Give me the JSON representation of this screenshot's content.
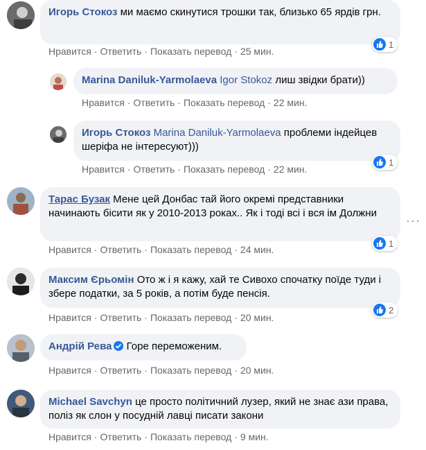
{
  "actions": {
    "like": "Нравится",
    "reply": "Ответить",
    "translate": "Показать перевод"
  },
  "comments": [
    {
      "author": "Игорь Стокоз",
      "text": "ми маємо скинутися трошки так, близько 65 ярдів грн.",
      "time": "25 мин.",
      "likes": "1"
    },
    {
      "author": "Marina Daniluk-Yarmolaeva",
      "mention": "Igor Stokoz",
      "text": "лиш звідки брати))",
      "time": "22 мин."
    },
    {
      "author": "Игорь Стокоз",
      "mention": "Marina Daniluk-Yarmolaeva",
      "text": "проблеми індейцев шеріфа не інтересуют)))",
      "time": "22 мин.",
      "likes": "1"
    },
    {
      "author": "Тарас Бузак",
      "text": "Мене цей Донбас тай його окремі представники начинають бісити як у 2010-2013 роках.. Як і тоді всі і вся ім Должни",
      "time": "24 мин.",
      "likes": "1"
    },
    {
      "author": "Максим Єрьомін",
      "text": "Ото ж і я кажу, хай те Сивохо спочатку поїде туди і збере податки, за 5 років, а потім буде пенсія.",
      "time": "20 мин.",
      "likes": "2"
    },
    {
      "author": "Андрій Рева",
      "text": "Горе переможеним.",
      "time": "20 мин."
    },
    {
      "author": "Michael Savchyn",
      "text": "це просто політичний лузер, який не знає ази права, поліз як слон у посудній лавці писати закони",
      "time": "9 мин."
    }
  ],
  "icons": {
    "like": "like-icon",
    "more": "more-options-icon",
    "verified": "verified-badge-icon"
  },
  "colors": {
    "link": "#385898",
    "bubble": "#f0f2f5",
    "meta": "#65676b",
    "like_blue": "#1877f2"
  }
}
